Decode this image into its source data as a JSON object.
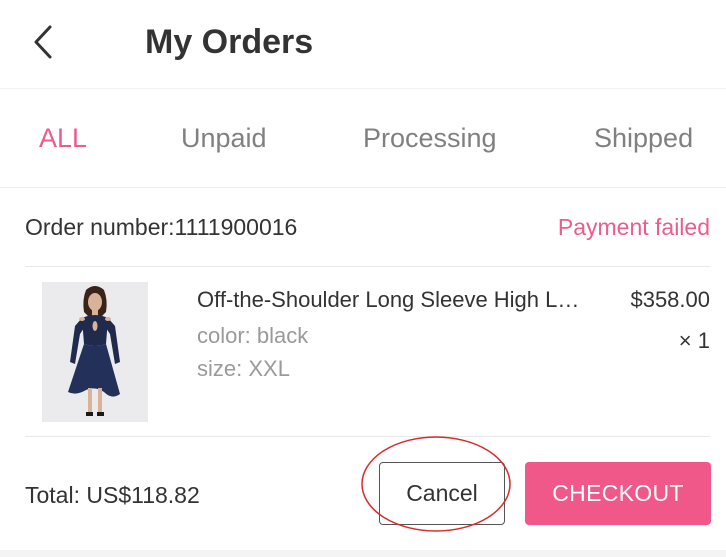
{
  "header": {
    "back_icon": "chevron-left-icon",
    "title": "My Orders"
  },
  "tabs": [
    {
      "label": "ALL",
      "active": true
    },
    {
      "label": "Unpaid",
      "active": false
    },
    {
      "label": "Processing",
      "active": false
    },
    {
      "label": "Shipped",
      "active": false
    }
  ],
  "order": {
    "number_label": "Order number:1111900016",
    "status": "Payment failed",
    "item": {
      "image_icon": "dress-product-image",
      "name": "Off-the-Shoulder Long Sleeve High Low Dress",
      "color": "color: black",
      "size": "size: XXL",
      "price": "$358.00",
      "quantity": "× 1"
    },
    "total": "Total: US$118.82",
    "cancel_label": "Cancel",
    "checkout_label": "CHECKOUT"
  },
  "colors": {
    "accent": "#ec5c8d",
    "checkout_bg": "#f0588a",
    "annotation": "#d92b2b"
  }
}
